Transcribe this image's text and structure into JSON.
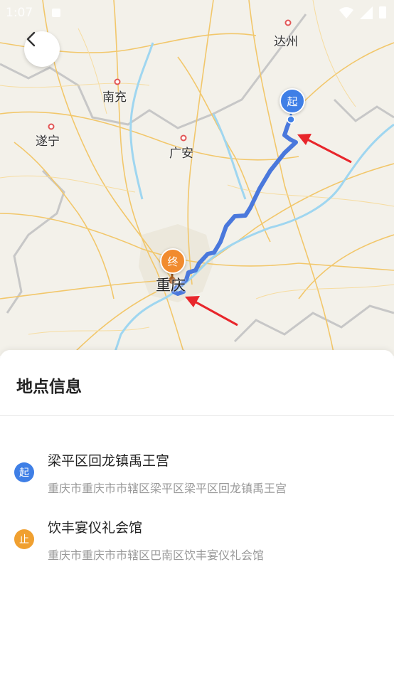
{
  "status_bar": {
    "time": "1:07"
  },
  "map": {
    "cities": [
      {
        "id": "dazhou",
        "name": "达州"
      },
      {
        "id": "nanchong",
        "name": "南充"
      },
      {
        "id": "suining",
        "name": "遂宁"
      },
      {
        "id": "guangan",
        "name": "广安"
      },
      {
        "id": "chongqing",
        "name": "重庆"
      }
    ],
    "start_marker": "起",
    "end_marker": "终",
    "colors": {
      "route": "#4a78dc",
      "start": "#3f7fe6",
      "end": "#f18b2f",
      "arrow": "#e8262b",
      "river": "#9fd6f0"
    }
  },
  "panel": {
    "title": "地点信息",
    "locations": [
      {
        "badge": "起",
        "name": "梁平区回龙镇禹王宫",
        "address": "重庆市重庆市市辖区梁平区梁平区回龙镇禹王宫",
        "color": "#3f7fe6"
      },
      {
        "badge": "止",
        "name": "饮丰宴仪礼会馆",
        "address": "重庆市重庆市市辖区巴南区饮丰宴仪礼会馆",
        "color": "#f0a030"
      }
    ]
  }
}
